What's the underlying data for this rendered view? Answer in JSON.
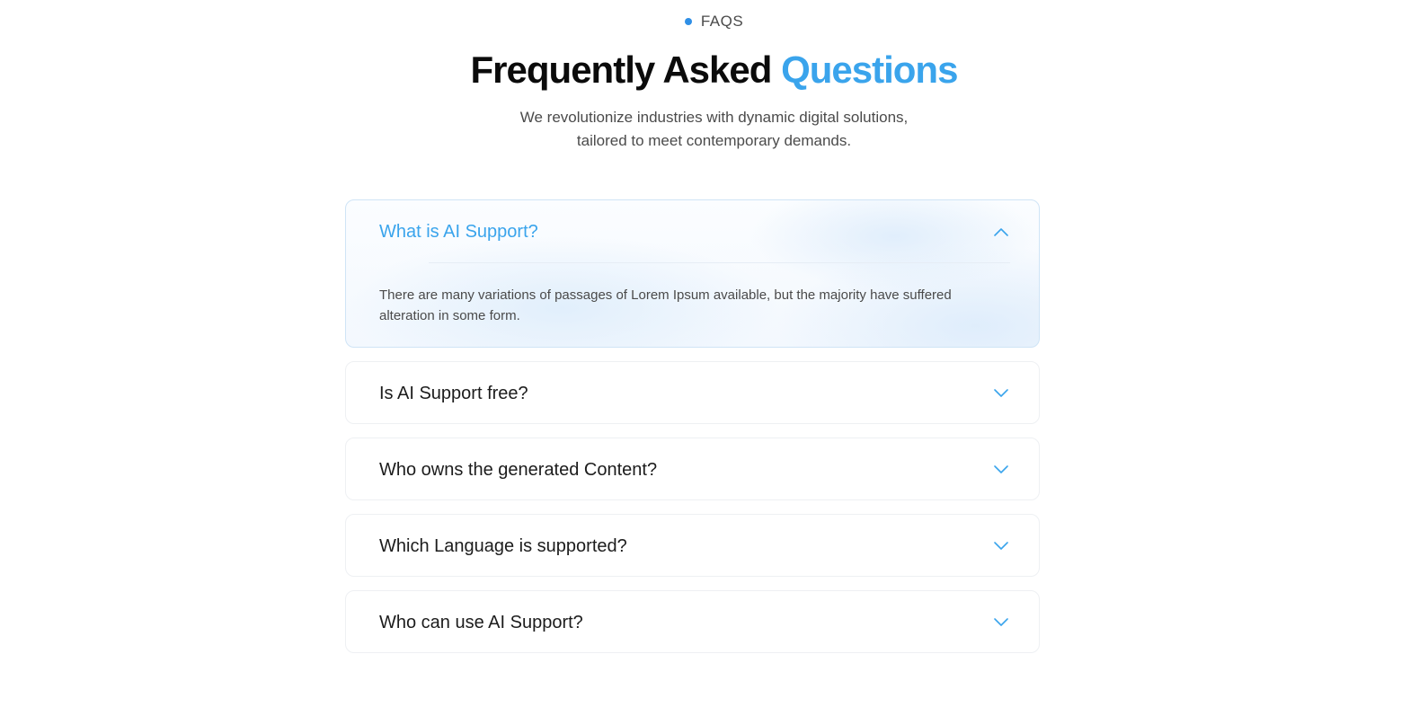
{
  "section": {
    "eyebrow": "FAQS",
    "title_main": "Frequently Asked",
    "title_accent": "Questions",
    "subtitle_line1": "We revolutionize industries with dynamic digital solutions,",
    "subtitle_line2": "tailored to meet contemporary demands."
  },
  "faqs": [
    {
      "question": "What is AI Support?",
      "answer": "There are many variations of passages of Lorem Ipsum available, but the majority have suffered alteration in some form.",
      "expanded": true
    },
    {
      "question": "Is AI Support free?",
      "expanded": false
    },
    {
      "question": "Who owns the generated Content?",
      "expanded": false
    },
    {
      "question": "Which Language is supported?",
      "expanded": false
    },
    {
      "question": "Who can use AI Support?",
      "expanded": false
    }
  ],
  "icons": {
    "expanded": "chevron-up-icon",
    "collapsed": "chevron-down-icon"
  },
  "colors": {
    "accent": "#3aa4ec",
    "dot": "#2f8fe6",
    "heading": "#0b0b0b",
    "body_text": "#4a4a4a"
  }
}
